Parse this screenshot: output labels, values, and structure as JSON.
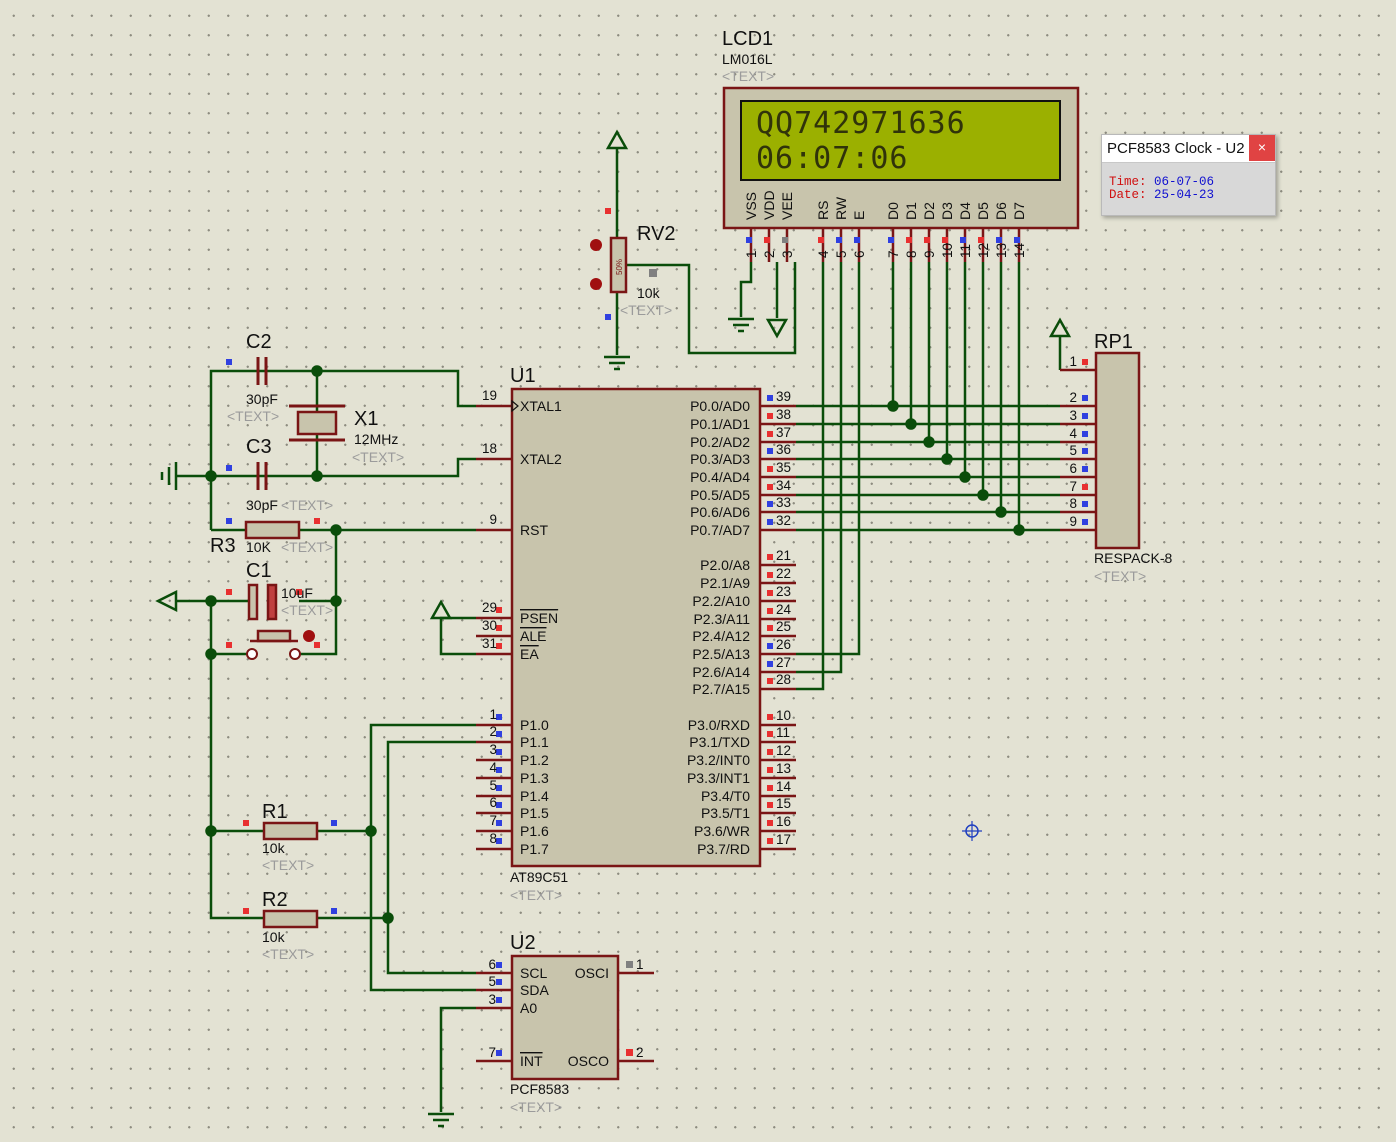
{
  "lcd": {
    "ref": "LCD1",
    "part": "LM016L",
    "text_tag": "<TEXT>",
    "line1": "QQ742971636",
    "line2": "06:07:06",
    "pin_names": [
      "VSS",
      "VDD",
      "VEE",
      "RS",
      "RW",
      "E",
      "D0",
      "D1",
      "D2",
      "D3",
      "D4",
      "D5",
      "D6",
      "D7"
    ],
    "pin_numbers": [
      "1",
      "2",
      "3",
      "4",
      "5",
      "6",
      "7",
      "8",
      "9",
      "10",
      "11",
      "12",
      "13",
      "14"
    ]
  },
  "rv2": {
    "ref": "RV2",
    "value": "10k",
    "text_tag": "<TEXT>",
    "percent": "50%"
  },
  "c2": {
    "ref": "C2",
    "value": "30pF",
    "text_tag": "<TEXT>"
  },
  "c3": {
    "ref": "C3",
    "value": "30pF",
    "text_tag": "<TEXT>"
  },
  "x1": {
    "ref": "X1",
    "value": "12MHz",
    "text_tag": "<TEXT>"
  },
  "r3": {
    "ref": "R3",
    "value": "10K",
    "text_tag": "<TEXT>"
  },
  "c1": {
    "ref": "C1",
    "value": "10uF",
    "text_tag": "<TEXT>"
  },
  "r1": {
    "ref": "R1",
    "value": "10k",
    "text_tag": "<TEXT>"
  },
  "r2": {
    "ref": "R2",
    "value": "10k",
    "text_tag": "<TEXT>"
  },
  "u1": {
    "ref": "U1",
    "part": "AT89C51",
    "text_tag": "<TEXT>",
    "left_pins": [
      {
        "num": "19",
        "name": "XTAL1"
      },
      {
        "num": "18",
        "name": "XTAL2"
      },
      {
        "num": "9",
        "name": "RST"
      },
      {
        "num": "29",
        "name": "PSEN"
      },
      {
        "num": "30",
        "name": "ALE"
      },
      {
        "num": "31",
        "name": "EA"
      },
      {
        "num": "1",
        "name": "P1.0"
      },
      {
        "num": "2",
        "name": "P1.1"
      },
      {
        "num": "3",
        "name": "P1.2"
      },
      {
        "num": "4",
        "name": "P1.3"
      },
      {
        "num": "5",
        "name": "P1.4"
      },
      {
        "num": "6",
        "name": "P1.5"
      },
      {
        "num": "7",
        "name": "P1.6"
      },
      {
        "num": "8",
        "name": "P1.7"
      }
    ],
    "right_pins": [
      {
        "num": "39",
        "name": "P0.0/AD0"
      },
      {
        "num": "38",
        "name": "P0.1/AD1"
      },
      {
        "num": "37",
        "name": "P0.2/AD2"
      },
      {
        "num": "36",
        "name": "P0.3/AD3"
      },
      {
        "num": "35",
        "name": "P0.4/AD4"
      },
      {
        "num": "34",
        "name": "P0.5/AD5"
      },
      {
        "num": "33",
        "name": "P0.6/AD6"
      },
      {
        "num": "32",
        "name": "P0.7/AD7"
      },
      {
        "num": "21",
        "name": "P2.0/A8"
      },
      {
        "num": "22",
        "name": "P2.1/A9"
      },
      {
        "num": "23",
        "name": "P2.2/A10"
      },
      {
        "num": "24",
        "name": "P2.3/A11"
      },
      {
        "num": "25",
        "name": "P2.4/A12"
      },
      {
        "num": "26",
        "name": "P2.5/A13"
      },
      {
        "num": "27",
        "name": "P2.6/A14"
      },
      {
        "num": "28",
        "name": "P2.7/A15"
      },
      {
        "num": "10",
        "name": "P3.0/RXD"
      },
      {
        "num": "11",
        "name": "P3.1/TXD"
      },
      {
        "num": "12",
        "name": "P3.2/INT0"
      },
      {
        "num": "13",
        "name": "P3.3/INT1"
      },
      {
        "num": "14",
        "name": "P3.4/T0"
      },
      {
        "num": "15",
        "name": "P3.5/T1"
      },
      {
        "num": "16",
        "name": "P3.6/WR"
      },
      {
        "num": "17",
        "name": "P3.7/RD"
      }
    ]
  },
  "rp1": {
    "ref": "RP1",
    "part": "RESPACK-8",
    "text_tag": "<TEXT>",
    "pins": [
      "1",
      "2",
      "3",
      "4",
      "5",
      "6",
      "7",
      "8",
      "9"
    ]
  },
  "u2": {
    "ref": "U2",
    "part": "PCF8583",
    "text_tag": "<TEXT>",
    "pins": [
      {
        "num": "6",
        "name": "SCL"
      },
      {
        "num": "5",
        "name": "SDA"
      },
      {
        "num": "3",
        "name": "A0"
      },
      {
        "num": "7",
        "name": "INT"
      },
      {
        "num": "1",
        "name": "OSCI"
      },
      {
        "num": "2",
        "name": "OSCO"
      }
    ]
  },
  "clock_popup": {
    "title": "PCF8583 Clock - U2",
    "close": "×",
    "time_label": "Time:",
    "time_value": "06-07-06",
    "date_label": "Date:",
    "date_value": "25-04-23"
  },
  "colors": {
    "wire": "#0a4d0a",
    "part_outline": "#7a1515",
    "part_fill": "#c8c4ac",
    "pin": "#7a1515",
    "pin_high": "#e83030",
    "pin_low": "#3040e0",
    "lcd_screen": "#9bb000",
    "background": "#e3e2d3"
  }
}
